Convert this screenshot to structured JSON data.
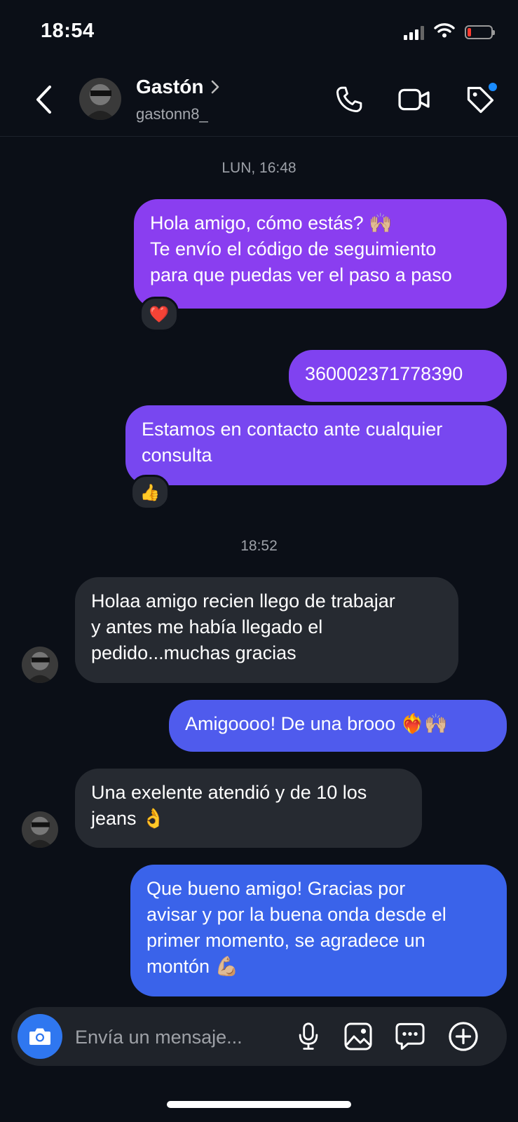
{
  "status_bar": {
    "time": "18:54",
    "battery_level": 0.1
  },
  "header": {
    "contact_name": "Gastón",
    "contact_handle": "gastonn8_",
    "icons": [
      "back-icon",
      "phone-icon",
      "video-camera-icon",
      "tag-icon"
    ],
    "notification_dot_color": "#1a8cff"
  },
  "messages": {
    "timestamp_1": "LUN, 16:48",
    "m1": {
      "direction": "outgoing",
      "lines": [
        "Hola amigo, cómo estás? 🙌🏼",
        "Te envío el código de seguimiento",
        "para que puedas ver el paso a paso"
      ],
      "reaction": "❤️"
    },
    "m2": {
      "direction": "outgoing",
      "text": "360002371778390"
    },
    "m3": {
      "direction": "outgoing",
      "lines": [
        "Estamos en contacto ante cualquier",
        "consulta"
      ],
      "reaction": "👍"
    },
    "timestamp_2": "18:52",
    "m4": {
      "direction": "incoming",
      "lines": [
        "Holaa amigo recien llego de trabajar",
        "y antes me había llegado el",
        "pedido...muchas gracias"
      ]
    },
    "m5": {
      "direction": "outgoing",
      "text": "Amigoooo! De una brooo ❤️‍🔥🙌🏼"
    },
    "m6": {
      "direction": "incoming",
      "lines": [
        "Una exelente atendió y de 10 los",
        "jeans 👌"
      ]
    },
    "m7": {
      "direction": "outgoing",
      "lines": [
        "Que bueno amigo! Gracias por",
        "avisar y por la buena onda desde el",
        "primer momento, se agradece un",
        "montón 💪🏼"
      ]
    }
  },
  "composer": {
    "placeholder": "Envía un mensaje...",
    "icons": [
      "camera-icon",
      "microphone-icon",
      "gallery-icon",
      "sticker-icon",
      "plus-icon"
    ]
  },
  "colors": {
    "background": "#0b0f17",
    "bubble_outgoing_top": "#8a3ef0",
    "bubble_outgoing_bottom": "#3a63ea",
    "bubble_incoming": "#262a31",
    "camera_button": "#2f77f0"
  }
}
